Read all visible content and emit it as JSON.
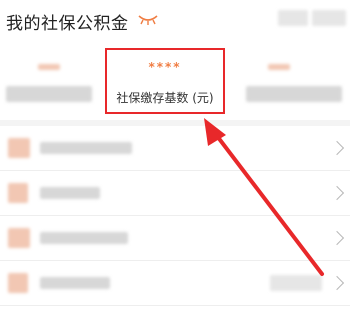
{
  "header": {
    "title": "我的社保公积金",
    "icon": "eye-closed-icon"
  },
  "summary": {
    "highlight": {
      "value_masked": "****",
      "label": "社保缴存基数 (元)"
    }
  },
  "list": {
    "rows": [
      {
        "icon": "chevron-right-icon"
      },
      {
        "icon": "chevron-right-icon"
      },
      {
        "icon": "chevron-right-icon"
      },
      {
        "icon": "chevron-right-icon"
      }
    ]
  },
  "colors": {
    "accent": "#e8282a",
    "value_orange": "#f07d43",
    "background": "#f4f4f4"
  }
}
